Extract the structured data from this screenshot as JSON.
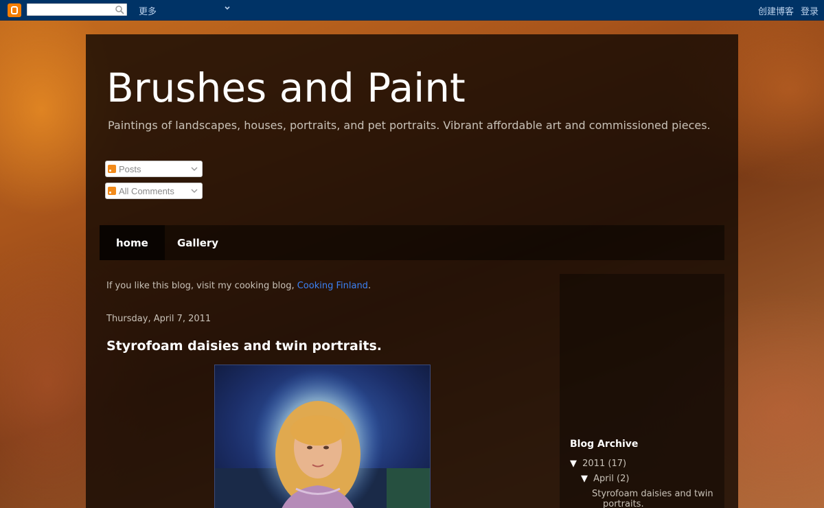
{
  "navbar": {
    "more_label": "更多",
    "create_blog_label": "创建博客",
    "login_label": "登录"
  },
  "blog": {
    "title": "Brushes and Paint",
    "description": "Paintings of landscapes, houses, portraits, and pet portraits. Vibrant affordable art and commissioned pieces."
  },
  "feeds": {
    "posts_label": "Posts",
    "comments_label": "All Comments"
  },
  "tabs": [
    {
      "label": "home"
    },
    {
      "label": "Gallery"
    }
  ],
  "intro": {
    "text_before": "If you like this blog, visit my cooking blog, ",
    "link_text": "Cooking Finland",
    "text_after": "."
  },
  "post": {
    "date": "Thursday, April 7, 2011",
    "title": "Styrofoam daisies and twin portraits."
  },
  "sidebar": {
    "archive_title": "Blog Archive",
    "year": {
      "label": "2011",
      "count": "(17)"
    },
    "month": {
      "label": "April",
      "count": "(2)"
    },
    "post_line1": "Styrofoam daisies and twin",
    "post_line2": "portraits."
  },
  "colors": {
    "navbar": "#003366",
    "link": "#3b82f6",
    "blogger_orange": "#f57d00"
  }
}
